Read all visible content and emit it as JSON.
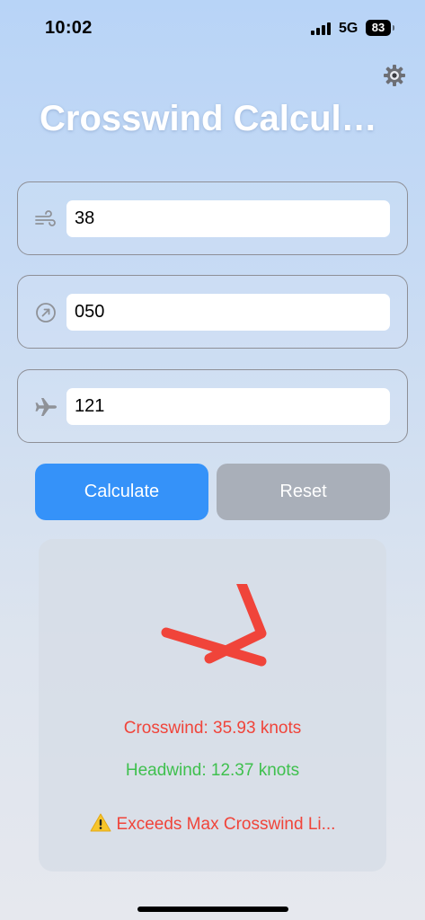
{
  "status_bar": {
    "time": "10:02",
    "network": "5G",
    "battery": "83"
  },
  "header": {
    "title": "Crosswind Calcula..."
  },
  "fields": {
    "wind_speed": {
      "icon": "wind-icon",
      "value": "38"
    },
    "wind_direction": {
      "icon": "compass-arrow-icon",
      "value": "050"
    },
    "runway_heading": {
      "icon": "airplane-icon",
      "value": "121"
    }
  },
  "buttons": {
    "calculate_label": "Calculate",
    "reset_label": "Reset"
  },
  "results": {
    "crosswind": "Crosswind: 35.93 knots",
    "headwind": "Headwind: 12.37 knots",
    "warning": "Exceeds Max Crosswind Li..."
  },
  "colors": {
    "accent": "#3592f9",
    "reset": "#a9afb9",
    "crosswind": "#f0443a",
    "headwind": "#3fc04e",
    "arrow": "#f0443a"
  }
}
